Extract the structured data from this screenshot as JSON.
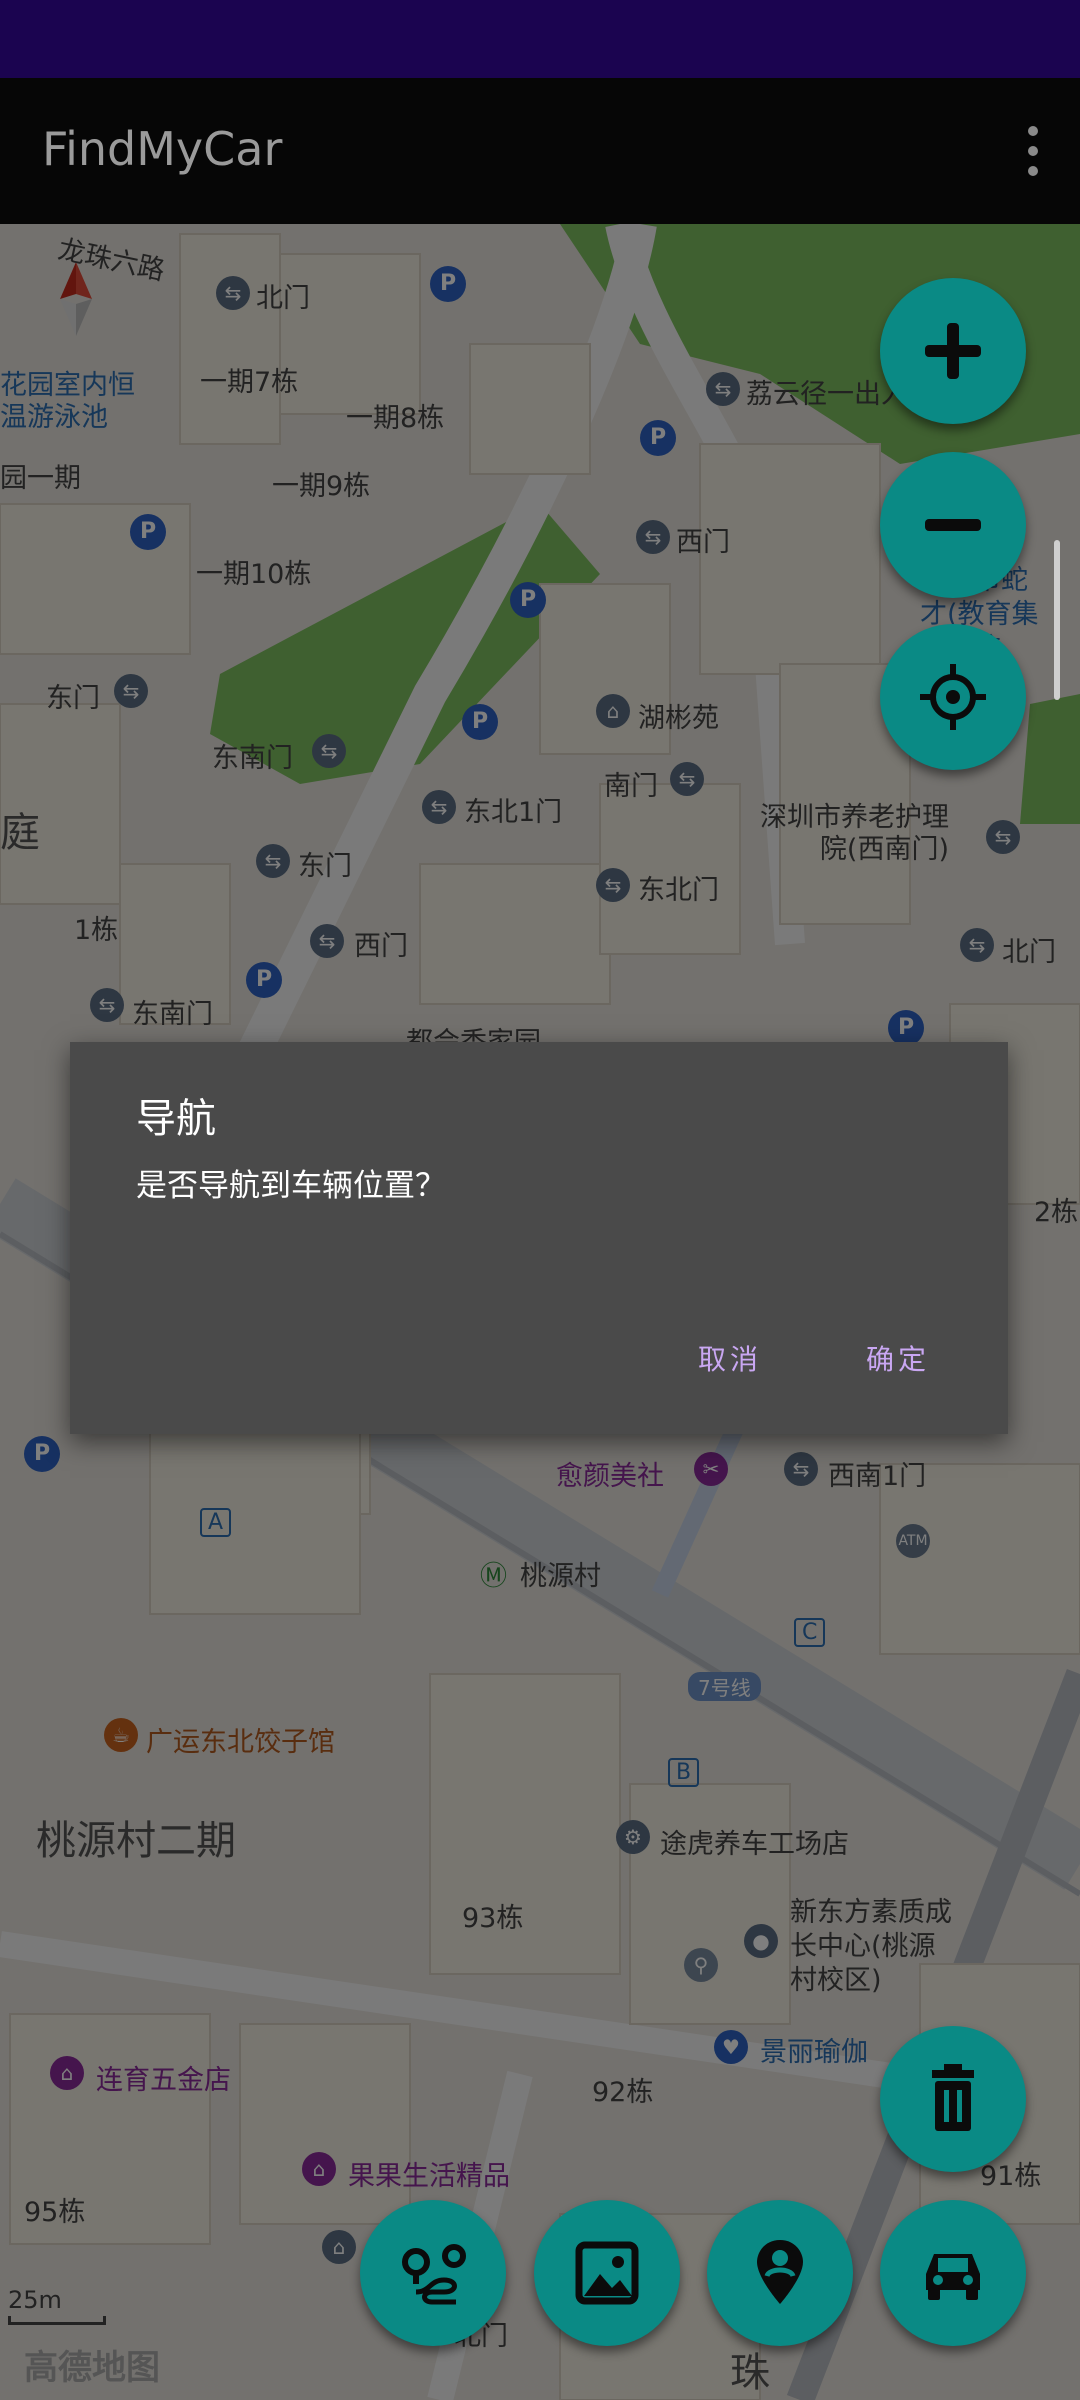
{
  "app": {
    "title": "FindMyCar",
    "menu_icon": "more-vert-icon"
  },
  "map": {
    "labels": {
      "road_top": "龙珠六路",
      "beimen_top": "北门",
      "garden_pool": "花园室内恒\n温游泳池",
      "yiqi7": "一期7栋",
      "yiqi8": "一期8栋",
      "yiqi9": "一期9栋",
      "yiqi10": "一期10栋",
      "yuan_yiqi": "园一期",
      "liyun": "荔云径一出入",
      "ximen1": "西门",
      "dongmen1": "东门",
      "dongnanmen1": "东南门",
      "hubinyuan": "湖彬苑",
      "nanmen": "南门",
      "dongbei1men": "东北1门",
      "yangjie": "深圳市养老护理\n院(西南门)",
      "dongmen2": "东门",
      "dongbeimen": "东北门",
      "tingleft": "庭",
      "ximen2": "西门",
      "beimen_right": "北门",
      "dong1": "1栋",
      "dongnanmen2": "东南门",
      "huiquan": "都会香家园",
      "dong2": "2栋",
      "yuyan": "愈颜美社",
      "xinan1men": "西南1门",
      "taoyuancun": "桃源村",
      "line7": "7号线",
      "guangyun": "广运东北饺子馆",
      "taoyuan2": "桃源村二期",
      "tuhu": "途虎养车工场店",
      "dong93": "93栋",
      "xdf": "新东方素质成\n长中心(桃源\n村校区)",
      "jingli": "景丽瑜伽",
      "lianyu": "连育五金店",
      "dong92": "92栋",
      "guoguo": "果果生活精品",
      "dong95": "95栋",
      "dong91": "91栋",
      "beimen_bottom": "北门",
      "zhu": "珠",
      "a_marker": "A",
      "b_marker": "B",
      "c_marker": "C",
      "atm": "ATM",
      "p": "P",
      "right_edge": "深圳市蛇\n才(教育集\n坑学校"
    },
    "scale": "25m",
    "provider": "高德地图"
  },
  "controls": {
    "zoom_in": "plus-icon",
    "zoom_out": "minus-icon",
    "locate": "crosshair-icon",
    "delete": "trash-icon",
    "route": "route-icon",
    "photo": "image-icon",
    "location_pin": "person-pin-icon",
    "car": "car-icon"
  },
  "dialog": {
    "title": "导航",
    "message": "是否导航到车辆位置？",
    "cancel": "取消",
    "confirm": "确定"
  },
  "colors": {
    "status_bar": "#1b0450",
    "app_bar": "#060606",
    "fab": "#0a8a85",
    "dialog_bg": "#4a4a4a",
    "dialog_button": "#c9a7f2"
  }
}
